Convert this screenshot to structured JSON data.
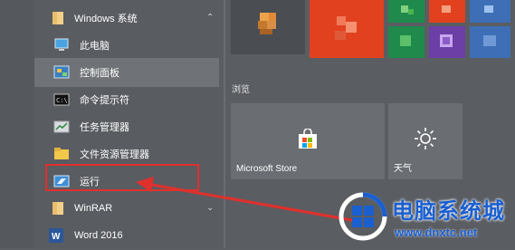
{
  "app_list": {
    "group": {
      "label": "Windows 系统",
      "icon": "folder-icon",
      "chevron": "chevron-up-icon"
    },
    "items": [
      {
        "label": "此电脑",
        "icon": "computer-icon"
      },
      {
        "label": "控制面板",
        "icon": "control-panel-icon"
      },
      {
        "label": "命令提示符",
        "icon": "command-prompt-icon"
      },
      {
        "label": "任务管理器",
        "icon": "task-manager-icon"
      },
      {
        "label": "文件资源管理器",
        "icon": "file-explorer-icon"
      },
      {
        "label": "运行",
        "icon": "run-icon"
      }
    ],
    "winrar": {
      "label": "WinRAR",
      "icon": "folder-icon",
      "chevron": "chevron-down-icon"
    },
    "word": {
      "label": "Word 2016",
      "icon": "word-icon"
    }
  },
  "tiles": {
    "section_label": "浏览",
    "store": {
      "label": "Microsoft Store",
      "icon": "store-bag-icon"
    },
    "weather": {
      "label": "天气",
      "icon": "sun-icon"
    }
  },
  "annotation": {
    "color": "#e0302c"
  },
  "watermark": {
    "brand": "电脑系统城",
    "url": "www.dnxtc.net",
    "color": "#1a5fd0"
  }
}
